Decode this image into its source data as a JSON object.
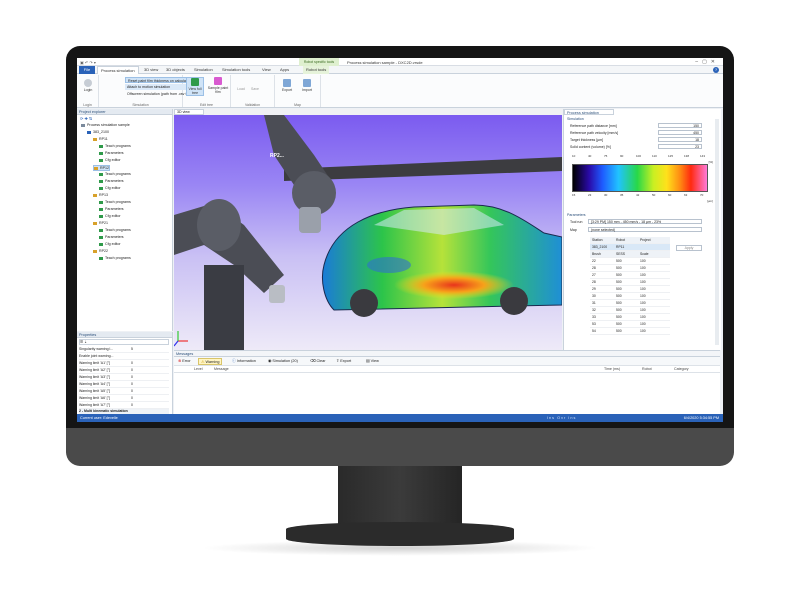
{
  "app": {
    "title": "Process simulation sample - DXC2D.vrsde",
    "context_tab_group": "Robot specific tools"
  },
  "tabs": [
    "File",
    "Process simulation",
    "3D view",
    "3D objects",
    "Simulation",
    "Simulation tools",
    "View",
    "Apps",
    "Robot tools"
  ],
  "ribbon": {
    "login_label": "Login",
    "group_simulation": "Simulation",
    "menu_items": [
      "Reset paint film thickness on calculation start",
      "Attach to motion simulation",
      "Offscreen simulation (path from .csv file)"
    ],
    "group_login": "Login",
    "btn_view_full": "View full tree",
    "btn_sample_paint": "Sample paint film",
    "group_edit_tree": "Edit tree",
    "group_validation": "Validation",
    "btn_load": "Load",
    "btn_save": "Save",
    "btn_export": "Export",
    "btn_import": "Import",
    "group_map": "Map"
  },
  "explorer": {
    "title": "Project explorer",
    "items": [
      {
        "label": "Process simulation sample",
        "level": 0
      },
      {
        "label": "383_2100",
        "level": 1
      },
      {
        "label": "RP11",
        "level": 2
      },
      {
        "label": "Teach programs",
        "level": 3
      },
      {
        "label": "Parameters",
        "level": 3
      },
      {
        "label": "Cfg editor",
        "level": 3
      },
      {
        "label": "RP12",
        "level": 2
      },
      {
        "label": "Teach programs",
        "level": 3
      },
      {
        "label": "Parameters",
        "level": 3
      },
      {
        "label": "Cfg editor",
        "level": 3
      },
      {
        "label": "RP13",
        "level": 2
      },
      {
        "label": "Teach programs",
        "level": 3
      },
      {
        "label": "Parameters",
        "level": 3
      },
      {
        "label": "Cfg editor",
        "level": 3
      },
      {
        "label": "RP21",
        "level": 2
      },
      {
        "label": "Teach programs",
        "level": 3
      },
      {
        "label": "Parameters",
        "level": 3
      },
      {
        "label": "Cfg editor",
        "level": 3
      },
      {
        "label": "RP22",
        "level": 2
      },
      {
        "label": "Teach programs",
        "level": 3
      }
    ]
  },
  "properties": {
    "title": "Properties",
    "rows": [
      {
        "label": "Singularity warning l...",
        "value": "5"
      },
      {
        "label": "Enable joint warning...",
        "value": ""
      },
      {
        "label": "Warning limit 'A1' [°]",
        "value": "0"
      },
      {
        "label": "Warning limit 'A2' [°]",
        "value": "0"
      },
      {
        "label": "Warning limit 'A3' [°]",
        "value": "0"
      },
      {
        "label": "Warning limit 'A4' [°]",
        "value": "0"
      },
      {
        "label": "Warning limit 'A5' [°]",
        "value": "0"
      },
      {
        "label": "Warning limit 'A6' [°]",
        "value": "0"
      },
      {
        "label": "Warning limit 'A7' [°]",
        "value": "0"
      }
    ],
    "section": "2 - Multi kinematic simulation",
    "active_label": "Active",
    "desc_title": "Active",
    "desc_text": "Use robot for multi kinematic simulation"
  },
  "viewport": {
    "tab": "3D view",
    "label_rp": "RP2..."
  },
  "procsim": {
    "title": "Process simulation",
    "sec_simulation": "Simulation",
    "fields": [
      {
        "label": "Reference path distance [mm]",
        "value": "150"
      },
      {
        "label": "Reference path velocity [mm/s]",
        "value": "450"
      },
      {
        "label": "Target thickness [µm]",
        "value": "18"
      },
      {
        "label": "Solid content (volume) [%]",
        "value": "23"
      }
    ],
    "scale_top": [
      "10",
      "40",
      "75",
      "90",
      "100",
      "110",
      "125",
      "138",
      "143"
    ],
    "scale_bottom": [
      "15",
      "23",
      "30",
      "35",
      "42",
      "50",
      "60",
      "63",
      "70"
    ],
    "scale_unit_top": "[%]",
    "scale_unit_bottom": "[µm]",
    "sec_parameters": "Parameters",
    "tool_run_label": "Tool run",
    "tool_run_value": "[3:29 PM] 150 mm - 450 mm/s - 18 µm - 23%",
    "map_label": "Map",
    "map_value": "(none selected)",
    "grid_head": [
      "Station",
      "Robot",
      "Project"
    ],
    "grid_sel": [
      "383_2100",
      "RP11"
    ],
    "apply_label": "Apply",
    "grid_sub": [
      "Brush",
      "SESS",
      "Scale"
    ],
    "grid_rows": [
      [
        "22",
        "500",
        "100"
      ],
      [
        "28",
        "500",
        "100"
      ],
      [
        "27",
        "500",
        "100"
      ],
      [
        "28",
        "500",
        "100"
      ],
      [
        "29",
        "500",
        "100"
      ],
      [
        "30",
        "500",
        "100"
      ],
      [
        "31",
        "500",
        "100"
      ],
      [
        "32",
        "500",
        "100"
      ],
      [
        "33",
        "500",
        "100"
      ],
      [
        "53",
        "500",
        "100"
      ],
      [
        "54",
        "500",
        "100"
      ]
    ]
  },
  "messages": {
    "title": "Messages",
    "buttons": [
      "Error",
      "Warning",
      "Information",
      "Simulation (20)",
      "Clear",
      "Export",
      "View"
    ],
    "cols": [
      "Level",
      "Message",
      "Time (ms)",
      "Robot",
      "Category"
    ]
  },
  "status": {
    "user": "Current user: Edevelle",
    "datetime": "6/4/2020 5:34:55 PM",
    "indicators": "Ins  Ovr  Ins"
  }
}
